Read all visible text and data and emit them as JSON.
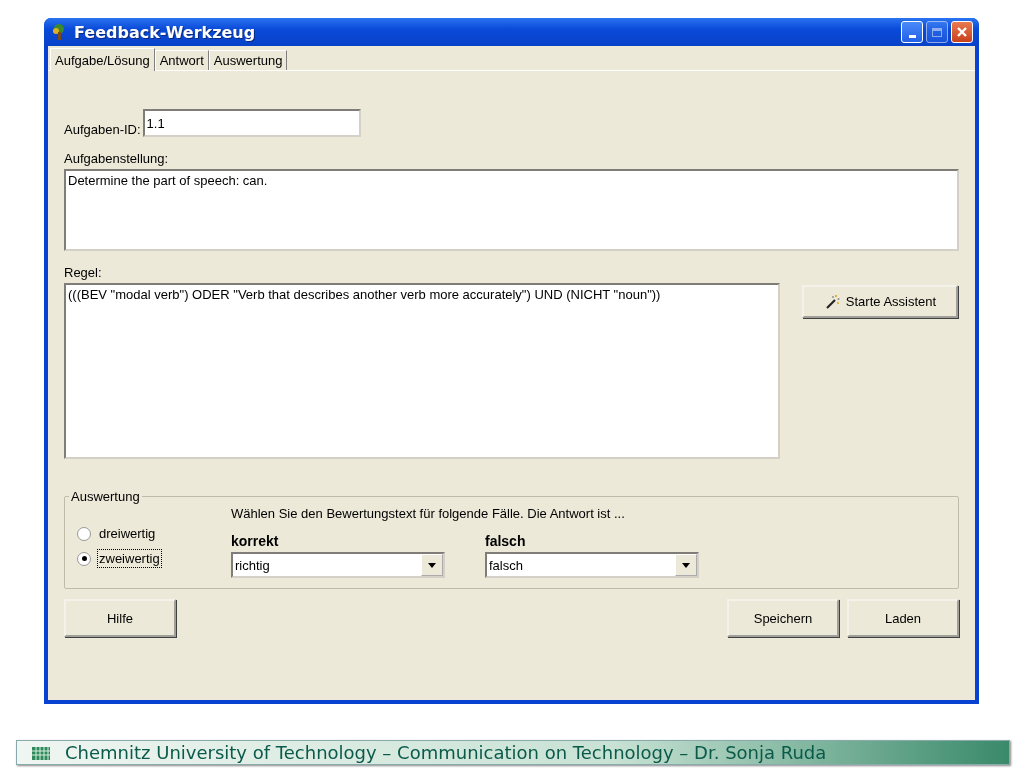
{
  "window": {
    "title": "Feedback-Werkzeug",
    "maximize_disabled": true
  },
  "tabs": [
    {
      "label": "Aufgabe/Lösung",
      "selected": true
    },
    {
      "label": "Antwort",
      "selected": false
    },
    {
      "label": "Auswertung",
      "selected": false
    }
  ],
  "task_id": {
    "label": "Aufgaben-ID:",
    "value": "1.1"
  },
  "task": {
    "label": "Aufgabenstellung:",
    "value": "Determine the part of speech: can."
  },
  "rule": {
    "label": "Regel:",
    "value": "(((BEV \"modal verb\") ODER \"Verb that describes another verb more accurately\") UND (NICHT \"noun\"))",
    "button": "Starte Assistent"
  },
  "evaluation": {
    "legend": "Auswertung",
    "hint": "Wählen Sie den Bewertungstext für folgende Fälle. Die Antwort ist ...",
    "options": [
      {
        "label": "dreiwertig",
        "selected": false
      },
      {
        "label": "zweiwertig",
        "selected": true
      }
    ],
    "dropdowns": [
      {
        "label": "korrekt",
        "value": "richtig"
      },
      {
        "label": "falsch",
        "value": "falsch"
      }
    ]
  },
  "buttons": {
    "left": [
      "Hilfe"
    ],
    "right": [
      "Speichern",
      "Laden"
    ]
  },
  "footer": "Chemnitz University of Technology – Communication on Technology – Dr. Sonja Ruda"
}
